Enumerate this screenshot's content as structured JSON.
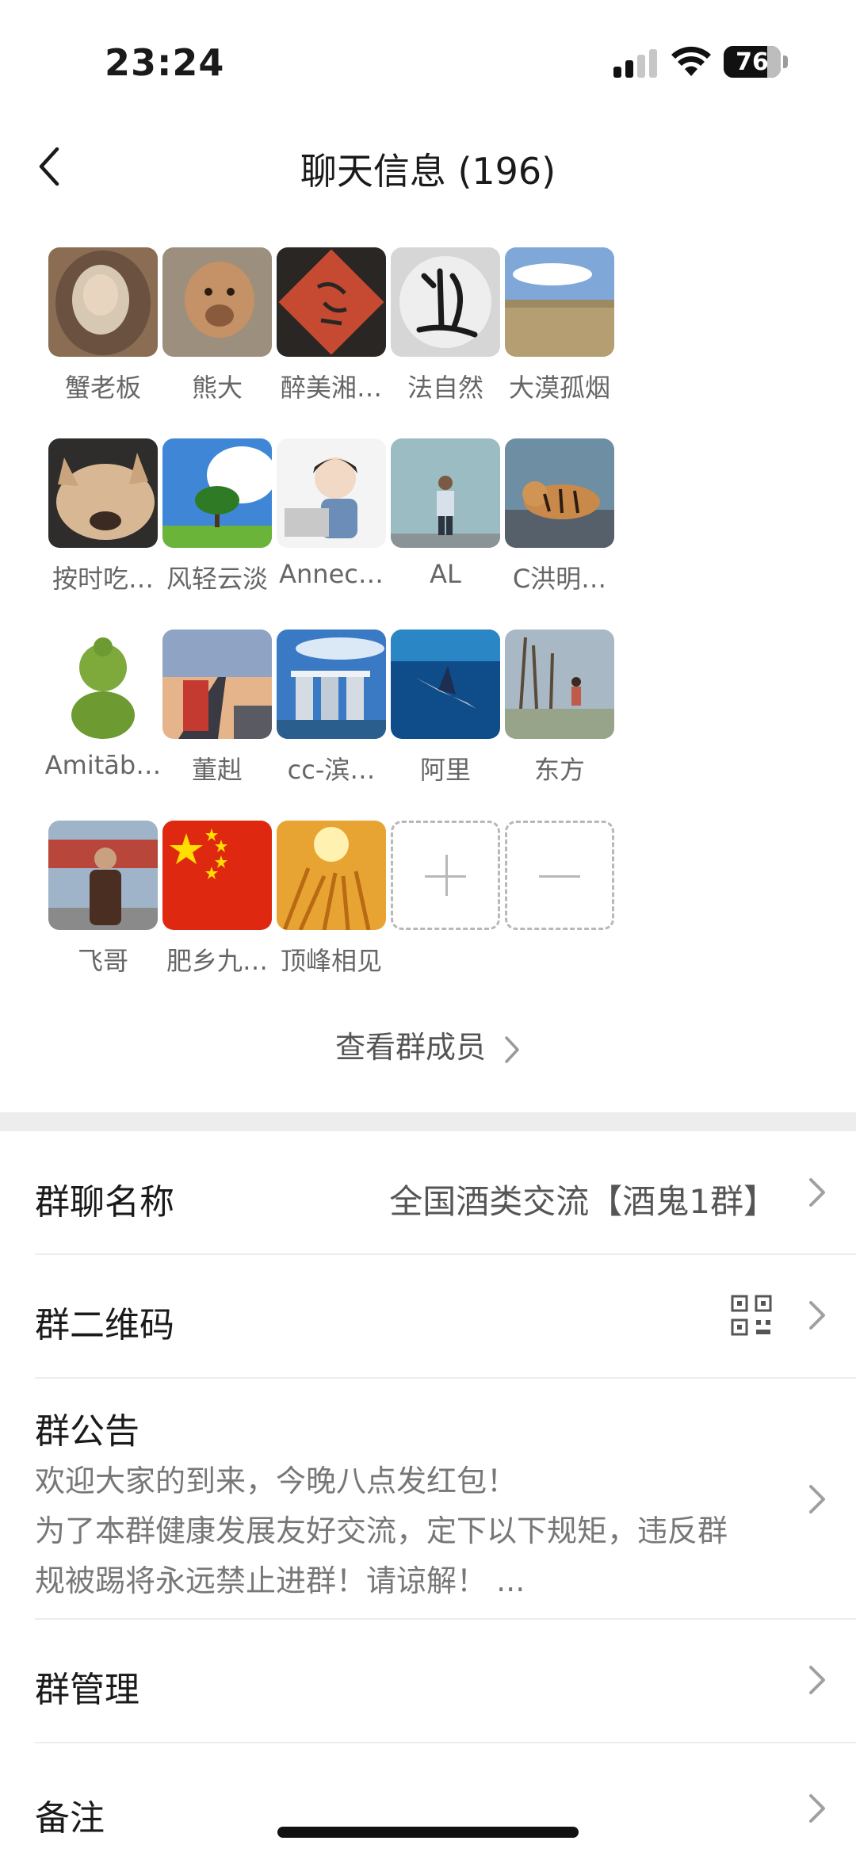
{
  "status_bar": {
    "time": "23:24",
    "battery": "76",
    "battery_level": 0.76
  },
  "nav": {
    "title": "聊天信息 (196)"
  },
  "members": [
    {
      "name": "蟹老板",
      "avatar_icon": "person-with-fur-hood-icon"
    },
    {
      "name": "熊大",
      "avatar_icon": "lion-cub-icon"
    },
    {
      "name": "醉美湘…",
      "avatar_icon": "red-calligraphy-seal-icon"
    },
    {
      "name": "法自然",
      "avatar_icon": "ink-calligraphy-icon"
    },
    {
      "name": "大漠孤烟",
      "avatar_icon": "grassland-landscape-icon"
    },
    {
      "name": "按时吃…",
      "avatar_icon": "sleeping-dog-icon"
    },
    {
      "name": "风轻云淡",
      "avatar_icon": "tree-blue-sky-icon"
    },
    {
      "name": "Annec…",
      "avatar_icon": "cartoon-girl-laptop-icon"
    },
    {
      "name": "AL",
      "avatar_icon": "man-in-front-of-wall-icon"
    },
    {
      "name": "C洪明…",
      "avatar_icon": "tiger-painting-icon"
    },
    {
      "name": "Amitāb…",
      "avatar_icon": "green-buddha-icon"
    },
    {
      "name": "董赳",
      "avatar_icon": "train-sunset-icon"
    },
    {
      "name": "cc-滨…",
      "avatar_icon": "city-skyline-icon"
    },
    {
      "name": "阿里",
      "avatar_icon": "swordfish-ocean-icon"
    },
    {
      "name": "东方",
      "avatar_icon": "people-by-trees-icon"
    },
    {
      "name": "飞哥",
      "avatar_icon": "man-leather-jacket-icon"
    },
    {
      "name": "肥乡九…",
      "avatar_icon": "china-flag-icon"
    },
    {
      "name": "顶峰相见",
      "avatar_icon": "golden-wheat-sun-icon"
    }
  ],
  "actions": {
    "add": "add-member-icon",
    "remove": "remove-member-icon"
  },
  "view_all": "查看群成员",
  "settings": {
    "group_name_label": "群聊名称",
    "group_name_value": "全国酒类交流【酒鬼1群】",
    "qr_label": "群二维码",
    "notice_label": "群公告",
    "notice_lines": [
      "欢迎大家的到来，今晚八点发红包！",
      "为了本群健康发展友好交流，定下以下规矩，违反群",
      "规被踢将永远禁止进群！请谅解！ ..."
    ],
    "manage_label": "群管理",
    "remark_label": "备注"
  }
}
